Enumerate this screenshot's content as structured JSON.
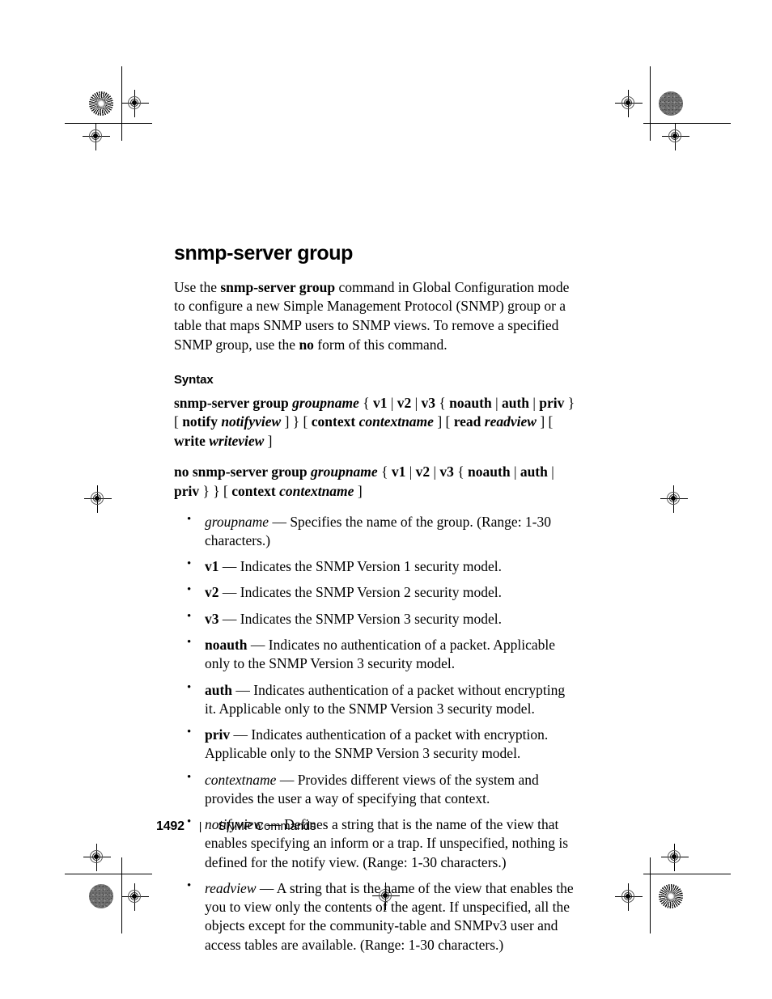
{
  "document": {
    "command_title": "snmp-server group",
    "intro": {
      "parts": [
        {
          "t": "Use the ",
          "s": "normal"
        },
        {
          "t": "snmp-server group",
          "s": "bold"
        },
        {
          "t": " command in Global Configuration mode to configure a new Simple Management Protocol (SNMP) group or a table that maps SNMP users to SNMP views. To remove a specified SNMP group, use the ",
          "s": "normal"
        },
        {
          "t": "no",
          "s": "bold"
        },
        {
          "t": " form of this command.",
          "s": "normal"
        }
      ],
      "plain": "Use the snmp-server group command in Global Configuration mode to configure a new Simple Management Protocol (SNMP) group or a table that maps SNMP users to SNMP views. To remove a specified SNMP group, use the no form of this command."
    },
    "syntax_heading": "Syntax",
    "syntax_lines": [
      {
        "plain": "snmp-server group groupname { v1 | v2 | v3 { noauth | auth | priv } [ notify notifyview ] } [ context contextname ] [ read readview ] [ write writeview ]",
        "parts": [
          {
            "t": "snmp-server group ",
            "s": "bold"
          },
          {
            "t": "groupname",
            "s": "bolditalic"
          },
          {
            "t": " { ",
            "s": "normal"
          },
          {
            "t": "v1",
            "s": "bold"
          },
          {
            "t": " | ",
            "s": "normal"
          },
          {
            "t": "v2",
            "s": "bold"
          },
          {
            "t": " | ",
            "s": "normal"
          },
          {
            "t": "v3",
            "s": "bold"
          },
          {
            "t": " { ",
            "s": "normal"
          },
          {
            "t": "noauth",
            "s": "bold"
          },
          {
            "t": " | ",
            "s": "normal"
          },
          {
            "t": "auth",
            "s": "bold"
          },
          {
            "t": " | ",
            "s": "normal"
          },
          {
            "t": "priv",
            "s": "bold"
          },
          {
            "t": " } [ ",
            "s": "normal"
          },
          {
            "t": "notify ",
            "s": "bold"
          },
          {
            "t": "notifyview",
            "s": "bolditalic"
          },
          {
            "t": " ] } [ ",
            "s": "normal"
          },
          {
            "t": "context ",
            "s": "bold"
          },
          {
            "t": "contextname",
            "s": "bolditalic"
          },
          {
            "t": " ] [ ",
            "s": "normal"
          },
          {
            "t": "read ",
            "s": "bold"
          },
          {
            "t": "readview",
            "s": "bolditalic"
          },
          {
            "t": " ] [ ",
            "s": "normal"
          },
          {
            "t": "write ",
            "s": "bold"
          },
          {
            "t": "writeview",
            "s": "bolditalic"
          },
          {
            "t": " ]",
            "s": "normal"
          }
        ]
      },
      {
        "plain": "no snmp-server group groupname { v1 | v2 | v3 { noauth | auth | priv } } [ context contextname ]",
        "parts": [
          {
            "t": "no snmp-server group ",
            "s": "bold"
          },
          {
            "t": "groupname",
            "s": "bolditalic"
          },
          {
            "t": " { ",
            "s": "normal"
          },
          {
            "t": "v1",
            "s": "bold"
          },
          {
            "t": " | ",
            "s": "normal"
          },
          {
            "t": "v2",
            "s": "bold"
          },
          {
            "t": " | ",
            "s": "normal"
          },
          {
            "t": "v3",
            "s": "bold"
          },
          {
            "t": " { ",
            "s": "normal"
          },
          {
            "t": "noauth",
            "s": "bold"
          },
          {
            "t": " | ",
            "s": "normal"
          },
          {
            "t": "auth",
            "s": "bold"
          },
          {
            "t": " | ",
            "s": "normal"
          },
          {
            "t": "priv",
            "s": "bold"
          },
          {
            "t": " } } [ ",
            "s": "normal"
          },
          {
            "t": "context ",
            "s": "bold"
          },
          {
            "t": "contextname",
            "s": "bolditalic"
          },
          {
            "t": " ]",
            "s": "normal"
          }
        ]
      }
    ],
    "parameters": [
      {
        "term": "groupname",
        "term_style": "italic",
        "description": " — Specifies the name of the group. (Range: 1-30 characters.)"
      },
      {
        "term": "v1",
        "term_style": "bold",
        "description": " — Indicates the SNMP Version 1 security model."
      },
      {
        "term": "v2",
        "term_style": "bold",
        "description": " — Indicates the SNMP Version 2 security model."
      },
      {
        "term": "v3",
        "term_style": "bold",
        "description": " — Indicates the SNMP Version 3 security model."
      },
      {
        "term": "noauth",
        "term_style": "bold",
        "description": " — Indicates no authentication of a packet. Applicable only to the SNMP Version 3 security model."
      },
      {
        "term": "auth",
        "term_style": "bold",
        "description": " — Indicates authentication of a packet without encrypting it. Applicable only to the SNMP Version 3 security model."
      },
      {
        "term": "priv",
        "term_style": "bold",
        "description": " — Indicates authentication of a packet with encryption. Applicable only to the SNMP Version 3 security model."
      },
      {
        "term": "contextname",
        "term_style": "italic",
        "description": " — Provides different views of the system and provides the user a way of specifying that context."
      },
      {
        "term": "notifyview",
        "term_style": "italic",
        "description": " — Defines a string that is the name of the view that enables specifying an inform or a trap. If unspecified, nothing is defined for the notify view. (Range: 1-30 characters.)"
      },
      {
        "term": "readview",
        "term_style": "italic",
        "description": " — A string that is the name of the view that enables the you to view only the contents of the agent. If unspecified, all the objects except for the community-table and SNMPv3 user and access tables are available. (Range: 1-30 characters.)"
      }
    ]
  },
  "footer": {
    "page_number": "1492",
    "separator": "|",
    "section": "SNMP Commands"
  },
  "print_marks": {
    "registration_mark_name": "registration-crosshair",
    "star_target_name": "halftone-star-target",
    "noise_target_name": "halftone-density-target"
  }
}
